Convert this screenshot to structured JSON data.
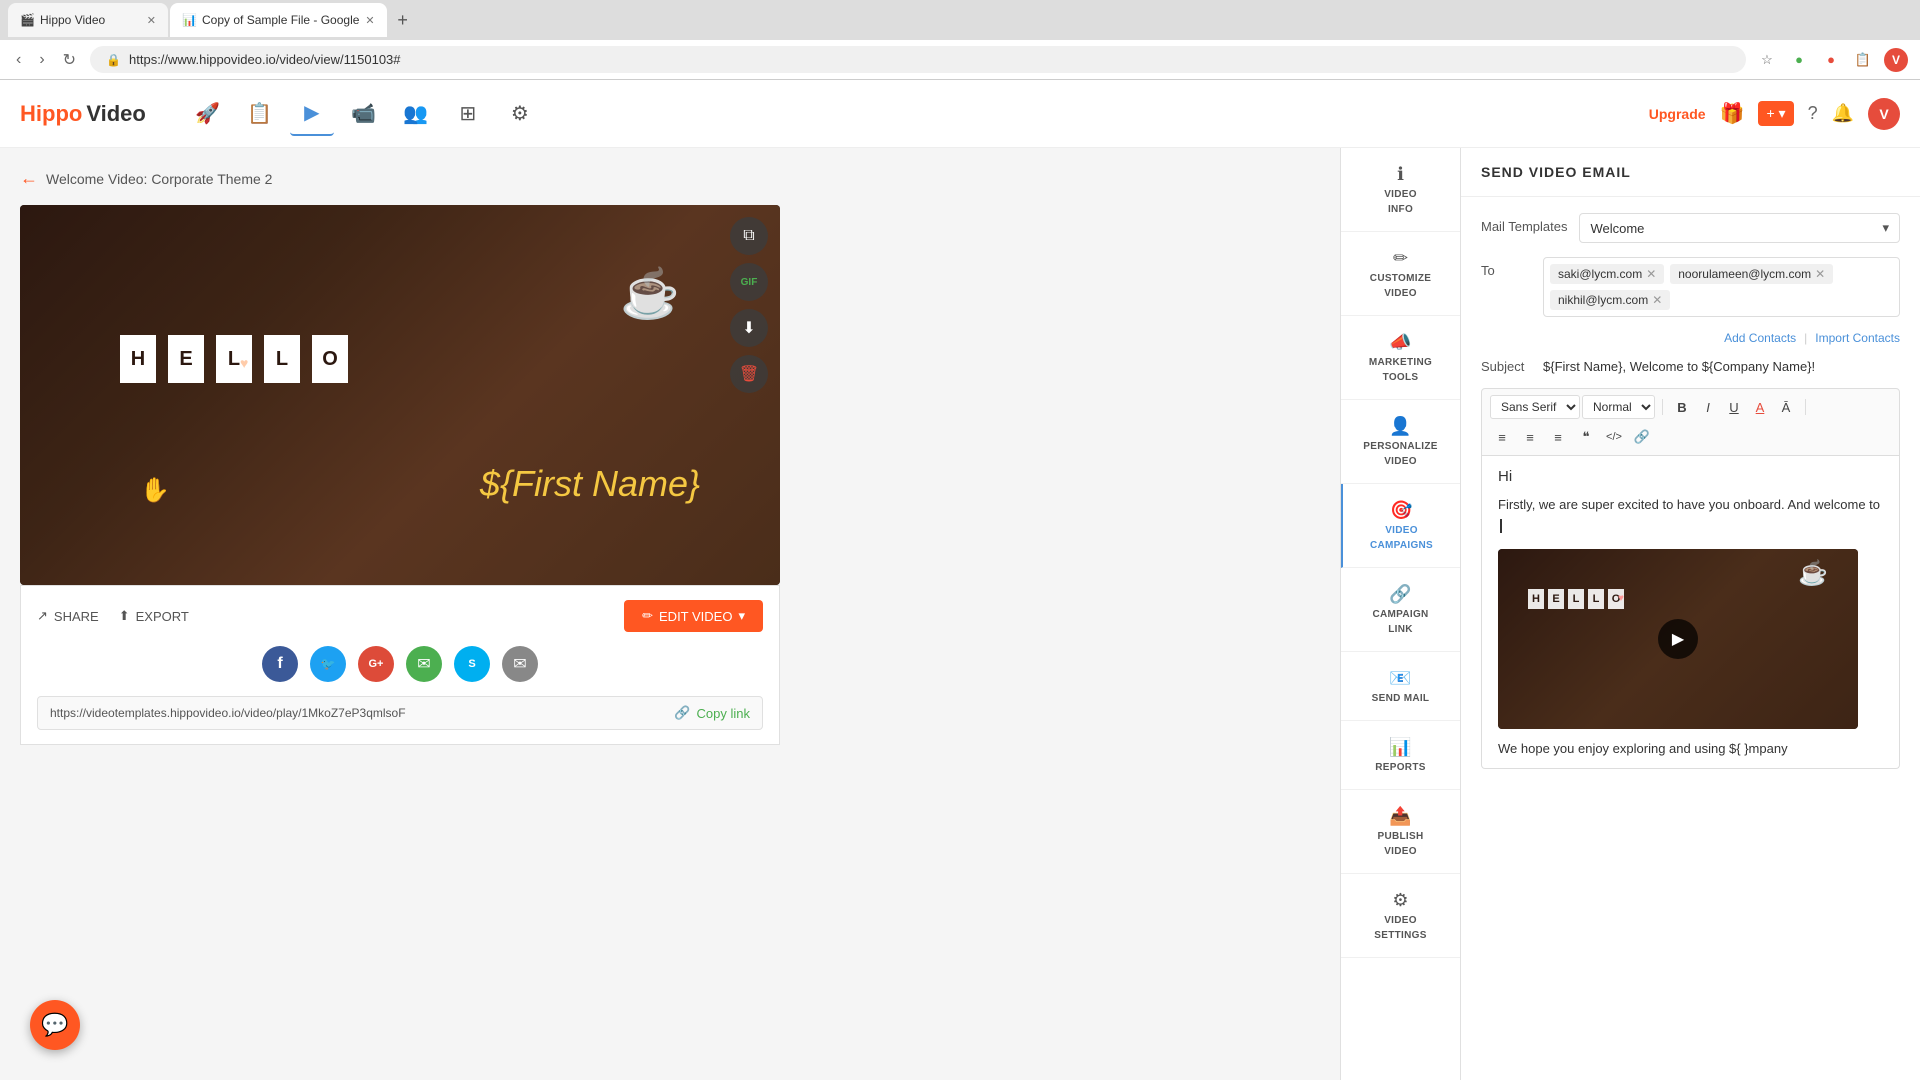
{
  "browser": {
    "tabs": [
      {
        "title": "Hippo Video",
        "favicon": "🎬",
        "active": false
      },
      {
        "title": "Copy of Sample File - Google",
        "favicon": "📊",
        "active": true
      }
    ],
    "url": "https://www.hippovideo.io/video/view/1150103#",
    "new_tab_label": "+"
  },
  "app_nav": {
    "logo_hippo": "Hippo",
    "logo_video": "Video",
    "icons": [
      {
        "name": "rocket-icon",
        "symbol": "🚀",
        "active": false
      },
      {
        "name": "contacts-icon",
        "symbol": "👤",
        "active": false
      },
      {
        "name": "video-library-icon",
        "symbol": "🎬",
        "active": true
      },
      {
        "name": "camera-icon",
        "symbol": "📹",
        "active": false
      },
      {
        "name": "people-icon",
        "symbol": "👥",
        "active": false
      },
      {
        "name": "widgets-icon",
        "symbol": "⚙",
        "active": false
      },
      {
        "name": "settings-icon",
        "symbol": "⚙",
        "active": false
      }
    ],
    "upgrade_label": "Upgrade",
    "gift_symbol": "🎁",
    "plus_label": "+ ▾",
    "help_symbol": "?",
    "bell_symbol": "🔔",
    "user_initial": "V"
  },
  "breadcrumb": {
    "arrow": "←",
    "title": "Welcome Video: Corporate Theme 2"
  },
  "video_actions": {
    "copy_label": "⧉",
    "gif_label": "GIF",
    "download_label": "⬇",
    "delete_label": "🗑"
  },
  "video_bottom": {
    "share_label": "SHARE",
    "export_label": "EXPORT",
    "edit_label": "EDIT VIDEO",
    "social_icons": [
      {
        "name": "facebook-icon",
        "class": "fb",
        "symbol": "f"
      },
      {
        "name": "twitter-icon",
        "class": "tw",
        "symbol": "t"
      },
      {
        "name": "googleplus-icon",
        "class": "gp",
        "symbol": "G+"
      },
      {
        "name": "embed-icon",
        "class": "em",
        "symbol": "✉"
      },
      {
        "name": "skype-icon",
        "class": "sk",
        "symbol": "S"
      },
      {
        "name": "mail-icon",
        "class": "mail",
        "symbol": "✉"
      }
    ],
    "link_url": "https://videotemplates.hippovideo.io/video/play/1MkoZ7eP3qmlsoF",
    "copy_link_label": "Copy link"
  },
  "sidebar": {
    "items": [
      {
        "name": "video-info-item",
        "label": "VIDEO\nINFO",
        "icon": "ℹ",
        "active": false
      },
      {
        "name": "customize-video-item",
        "label": "CUSTOMIZE\nVIDEO",
        "icon": "✏",
        "active": false
      },
      {
        "name": "marketing-tools-item",
        "label": "MARKETING\nTOOLS",
        "icon": "📣",
        "active": false
      },
      {
        "name": "personalize-video-item",
        "label": "PERSONALIZE\nVIDEO",
        "icon": "👤",
        "active": false
      },
      {
        "name": "video-campaigns-item",
        "label": "VIDEO\nCAMPAIGNS",
        "icon": "🎯",
        "active": true
      },
      {
        "name": "campaign-link-item",
        "label": "Campaign\nLink",
        "icon": "🔗",
        "active": false
      },
      {
        "name": "send-mail-item",
        "label": "Send Mail",
        "icon": "📧",
        "active": false
      },
      {
        "name": "reports-item",
        "label": "Reports",
        "icon": "📊",
        "active": false
      },
      {
        "name": "publish-video-item",
        "label": "PUBLISH\nVIDEO",
        "icon": "📤",
        "active": false
      },
      {
        "name": "video-settings-item",
        "label": "VIDEO\nSETTINGS",
        "icon": "⚙",
        "active": false
      }
    ]
  },
  "email_panel": {
    "title": "SEND VIDEO EMAIL",
    "mail_templates_label": "Mail Templates",
    "mail_template_value": "Welcome",
    "to_label": "To",
    "recipients": [
      {
        "email": "saki@lycm.com"
      },
      {
        "email": "noorulameen@lycm.com"
      },
      {
        "email": "nikhil@lycm.com"
      }
    ],
    "add_contacts_label": "Add Contacts",
    "import_contacts_label": "Import Contacts",
    "subject_label": "Subject",
    "subject_value": "${First Name}, Welcome to ${Company Name}!",
    "toolbar": {
      "font_family": "Sans Serif",
      "font_size": "Normal",
      "bold": "B",
      "italic": "I",
      "underline": "U",
      "font_color": "A",
      "highlight": "A̲",
      "ordered_list": "≡",
      "unordered_list": "≡",
      "align": "≡",
      "quote": "❝",
      "code": "</>",
      "link": "🔗"
    },
    "editor": {
      "greeting": "Hi",
      "body_text": "Firstly, we are super excited to have you onboard. And welcome to",
      "footer_text": "We hope you enjoy exploring and using ${ }mpany"
    }
  },
  "chat_fab": {
    "symbol": "💬"
  }
}
